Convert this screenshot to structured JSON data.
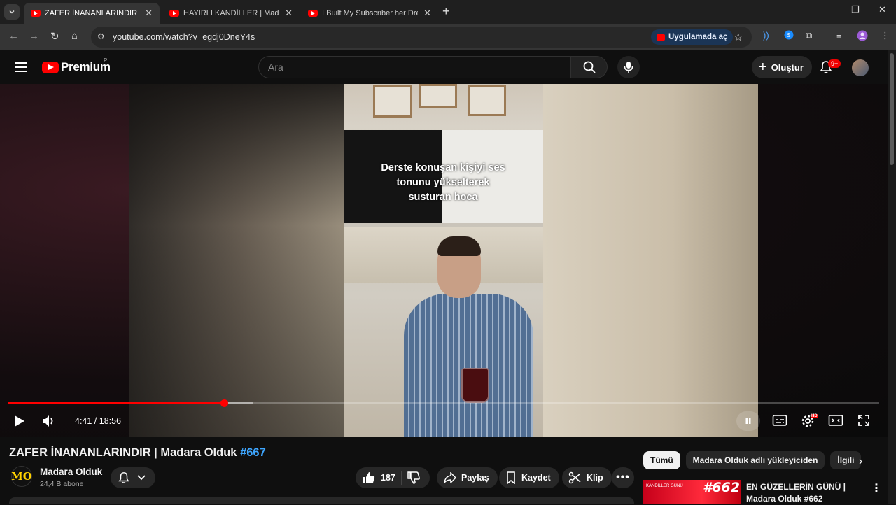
{
  "browser": {
    "tabs": [
      {
        "label": "ZAFER İNANANLARINDIR | Madara Olduk",
        "active": true
      },
      {
        "label": "HAYIRLI KANDİLLER | Madara Olduk",
        "active": false
      },
      {
        "label": "I Built My Subscriber her Dream",
        "active": false
      }
    ],
    "url": "youtube.com/watch?v=egdj0DneY4s",
    "open_in_app": "Uygulamada aç"
  },
  "header": {
    "logo_text": "Premium",
    "region": "PL",
    "search_placeholder": "Ara",
    "create_label": "Oluştur",
    "notifications_badge": "9+"
  },
  "player": {
    "caption_lines": [
      "Derste konuşan kişiyi ses",
      "tonunu yükselterek",
      "susturan hoca"
    ],
    "current_time": "4:41",
    "duration": "18:56",
    "time_display": "4:41 / 18:56",
    "progress_fraction": 0.2474,
    "buffered_fraction": 0.281,
    "quality_badge": "HD"
  },
  "video": {
    "title": "ZAFER İNANANLARINDIR | Madara Olduk",
    "hashtag": "#667",
    "channel_name": "Madara Olduk",
    "channel_initials": "MO",
    "subscribers": "24,4 B abone",
    "likes": "187",
    "share_label": "Paylaş",
    "save_label": "Kaydet",
    "clip_label": "Klip"
  },
  "sidebar": {
    "chips": [
      "Tümü",
      "Madara Olduk adlı yükleyiciden",
      "İlgili"
    ],
    "recommendation": {
      "title": "EN GÜZELLERİN GÜNÜ | Madara Olduk #662",
      "thumb_number": "#662",
      "thumb_text": "KANDİLLER GÜNÜ"
    }
  },
  "colors": {
    "brand_red": "#ff0000",
    "link_blue": "#3ea6ff",
    "background": "#0f0f0f"
  }
}
